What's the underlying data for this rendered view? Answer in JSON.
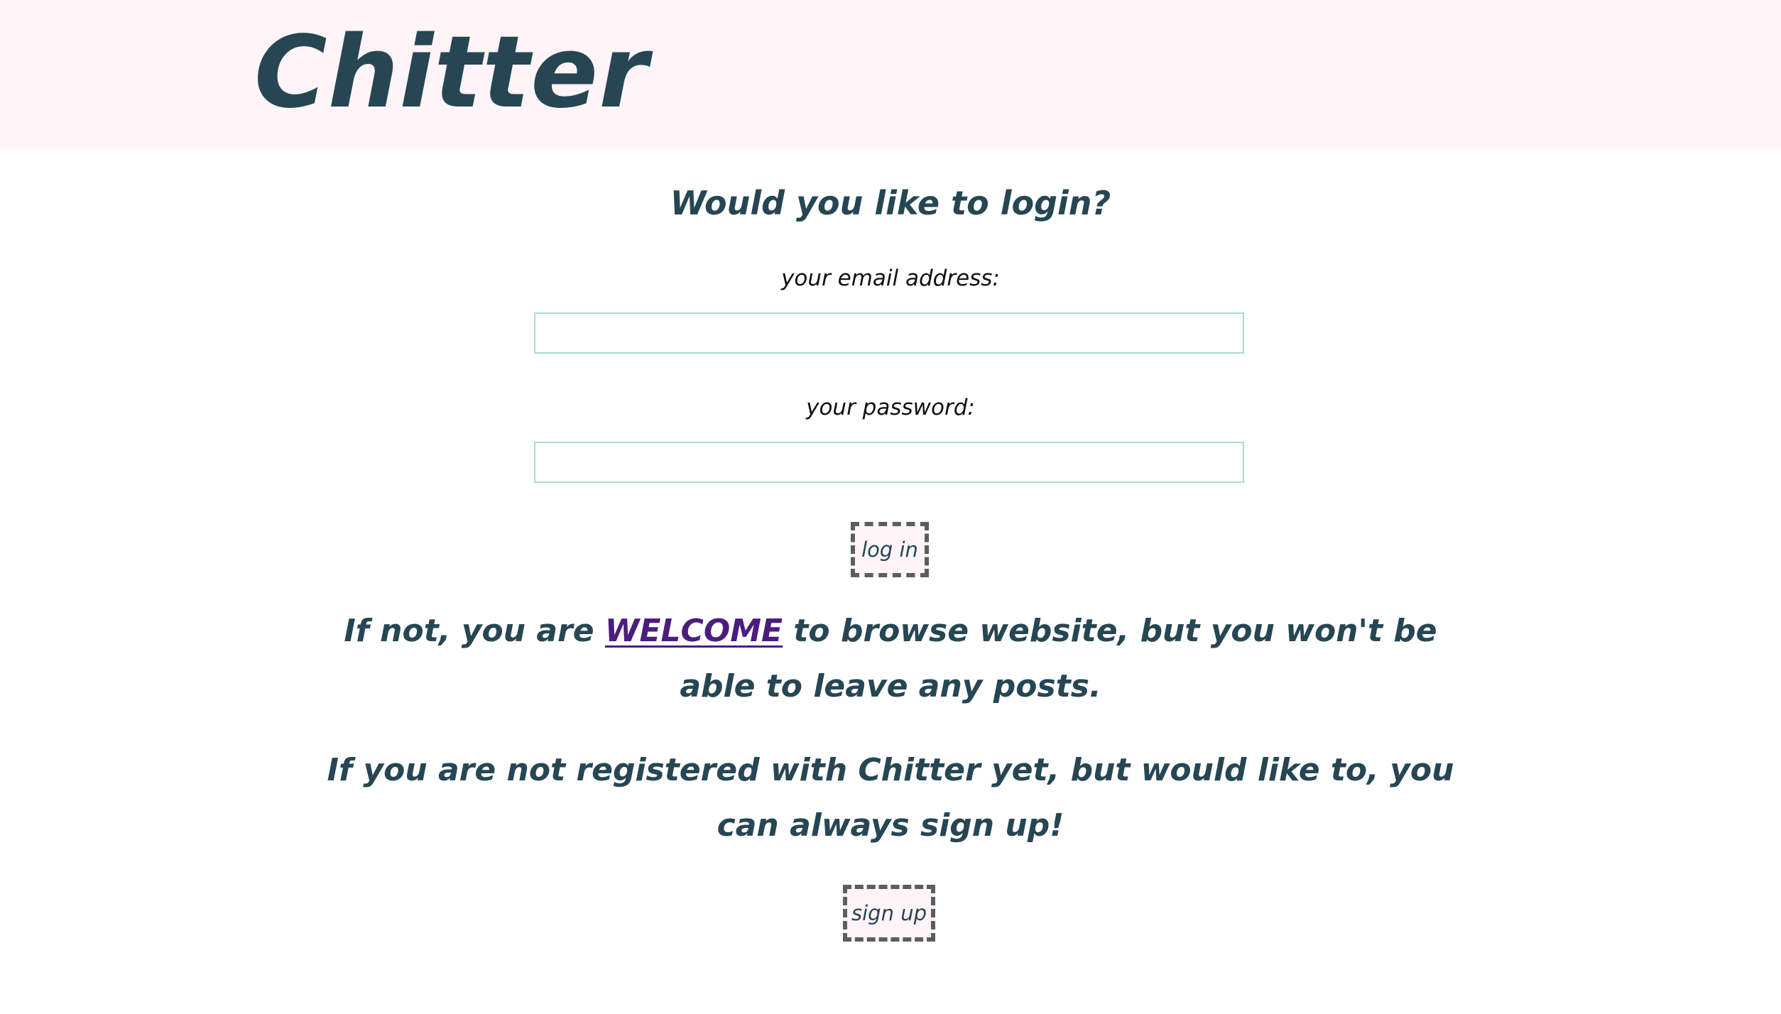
{
  "header": {
    "brand": "Chitter"
  },
  "login": {
    "heading": "Would you like to login?",
    "email_label": "your email address:",
    "email_value": "",
    "email_placeholder": "",
    "password_label": "your password:",
    "password_value": "",
    "password_placeholder": "",
    "submit_label": "log in"
  },
  "guest_notice": {
    "before_link": "If not, you are ",
    "link_text": "WELCOME",
    "after_link": " to browse website, but you won't be able to leave any posts."
  },
  "signup": {
    "message": "If you are not registered with Chitter yet, but would like to, you can always sign up!",
    "button_label": "sign up"
  },
  "colors": {
    "header_background": "#fff4f7",
    "text": "#264653",
    "input_border": "#a8dcd1",
    "link": "#4b1d7e",
    "button_border": "#5d5d5d"
  }
}
